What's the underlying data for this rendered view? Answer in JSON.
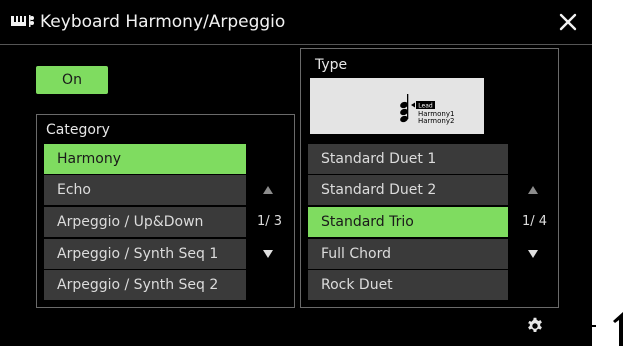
{
  "title": "Keyboard Harmony/Arpeggio",
  "on_button": "On",
  "category": {
    "label": "Category",
    "items": [
      "Harmony",
      "Echo",
      "Arpeggio / Up&Down",
      "Arpeggio / Synth Seq 1",
      "Arpeggio / Synth Seq 2"
    ],
    "selected_index": 0,
    "page": "1/ 3"
  },
  "type": {
    "label": "Type",
    "preview": {
      "lead": "Lead",
      "harmony1": "Harmony1",
      "harmony2": "Harmony2"
    },
    "items": [
      "Standard Duet 1",
      "Standard Duet 2",
      "Standard Trio",
      "Full Chord",
      "Rock Duet"
    ],
    "selected_index": 2,
    "page": "1/ 4"
  },
  "colors": {
    "accent": "#7fdc60",
    "background": "#000000",
    "row": "#3a3a3a"
  },
  "icons": {
    "title": "keyboard-harmony-icon",
    "close": "close-icon",
    "settings": "gear-icon"
  }
}
